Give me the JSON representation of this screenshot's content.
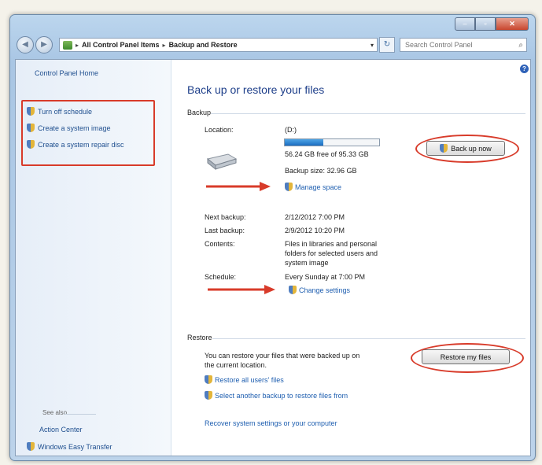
{
  "window": {
    "caption_buttons": {
      "minimize": "",
      "maximize": "",
      "close": ""
    }
  },
  "address_bar": {
    "segments": [
      "All Control Panel Items",
      "Backup and Restore"
    ],
    "separator": "▸"
  },
  "search": {
    "placeholder": "Search Control Panel"
  },
  "sidebar": {
    "home": "Control Panel Home",
    "tasks": [
      "Turn off schedule",
      "Create a system image",
      "Create a system repair disc"
    ],
    "see_also_label": "See also",
    "see_also": [
      "Action Center",
      "Windows Easy Transfer"
    ]
  },
  "main": {
    "title": "Back up or restore your files",
    "backup": {
      "section_label": "Backup",
      "location_label": "Location:",
      "location_value": "(D:)",
      "free_space": "56.24 GB free of 95.33 GB",
      "used_fraction": 0.41,
      "backup_size": "Backup size: 32.96 GB",
      "manage_space": "Manage space",
      "back_up_now": "Back up now",
      "next_backup_label": "Next backup:",
      "next_backup_value": "2/12/2012 7:00 PM",
      "last_backup_label": "Last backup:",
      "last_backup_value": "2/9/2012 10:20 PM",
      "contents_label": "Contents:",
      "contents_value_lines": [
        "Files in libraries and personal",
        "folders for selected users and",
        "system image"
      ],
      "schedule_label": "Schedule:",
      "schedule_value": "Every Sunday at 7:00 PM",
      "change_settings": "Change settings"
    },
    "restore": {
      "section_label": "Restore",
      "description_lines": [
        "You can restore your files that were backed up on",
        "the current location."
      ],
      "restore_my_files": "Restore my files",
      "restore_all_users": "Restore all users' files",
      "select_another": "Select another backup to restore files from",
      "recover_system": "Recover system settings or your computer"
    }
  },
  "colors": {
    "highlight": "#d83b2a",
    "link": "#1f5fb0",
    "title": "#1e3f8a"
  },
  "icons": [
    "back-icon",
    "forward-icon",
    "control-panel-icon",
    "refresh-icon",
    "search-icon",
    "shield-icon",
    "drive-icon",
    "help-icon",
    "arrow-icon"
  ]
}
